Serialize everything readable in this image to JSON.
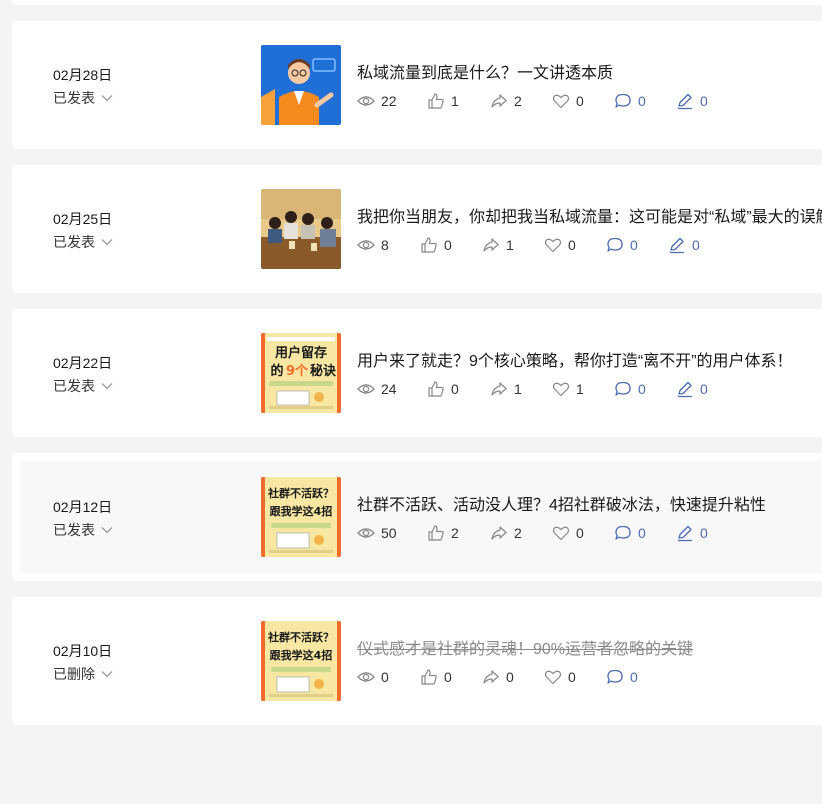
{
  "articles": [
    {
      "date": "02月28日",
      "status": "已发表",
      "title": "私域流量到底是什么？一文讲透本质",
      "thumbnail": "person-illustration",
      "views": "22",
      "likes": "1",
      "shares": "2",
      "favorites": "0",
      "comments": "0",
      "edits": "0",
      "deleted": false
    },
    {
      "date": "02月25日",
      "status": "已发表",
      "title": "我把你当朋友，你却把我当私域流量：这可能是对“私域”最大的误解",
      "thumbnail": "people-photo",
      "views": "8",
      "likes": "0",
      "shares": "1",
      "favorites": "0",
      "comments": "0",
      "edits": "0",
      "deleted": false
    },
    {
      "date": "02月22日",
      "status": "已发表",
      "title": "用户来了就走？9个核心策略，帮你打造“离不开”的用户体系！",
      "thumbnail": "poster-user-retention",
      "thumb_text": [
        "用户留存",
        "的",
        "9个",
        "秘诀"
      ],
      "views": "24",
      "likes": "0",
      "shares": "1",
      "favorites": "1",
      "comments": "0",
      "edits": "0",
      "deleted": false
    },
    {
      "date": "02月12日",
      "status": "已发表",
      "title": "社群不活跃、活动没人理？4招社群破冰法，快速提升粘性",
      "thumbnail": "poster-community",
      "thumb_text": [
        "社群不活跃？",
        "跟我学这4招"
      ],
      "views": "50",
      "likes": "2",
      "shares": "2",
      "favorites": "0",
      "comments": "0",
      "edits": "0",
      "deleted": false
    },
    {
      "date": "02月10日",
      "status": "已删除",
      "title": "仪式感才是社群的灵魂！90%运营者忽略的关键",
      "thumbnail": "poster-community",
      "thumb_text": [
        "社群不活跃？",
        "跟我学这4招"
      ],
      "views": "0",
      "likes": "0",
      "shares": "0",
      "favorites": "0",
      "comments": "0",
      "deleted": true
    }
  ],
  "colors": {
    "page_bg": "#f3f4f6",
    "card_bg": "#ffffff",
    "accent_blue": "#4d6bb3",
    "poster_orange": "#f26d2b",
    "poster_yellow": "#f7e7a3"
  }
}
